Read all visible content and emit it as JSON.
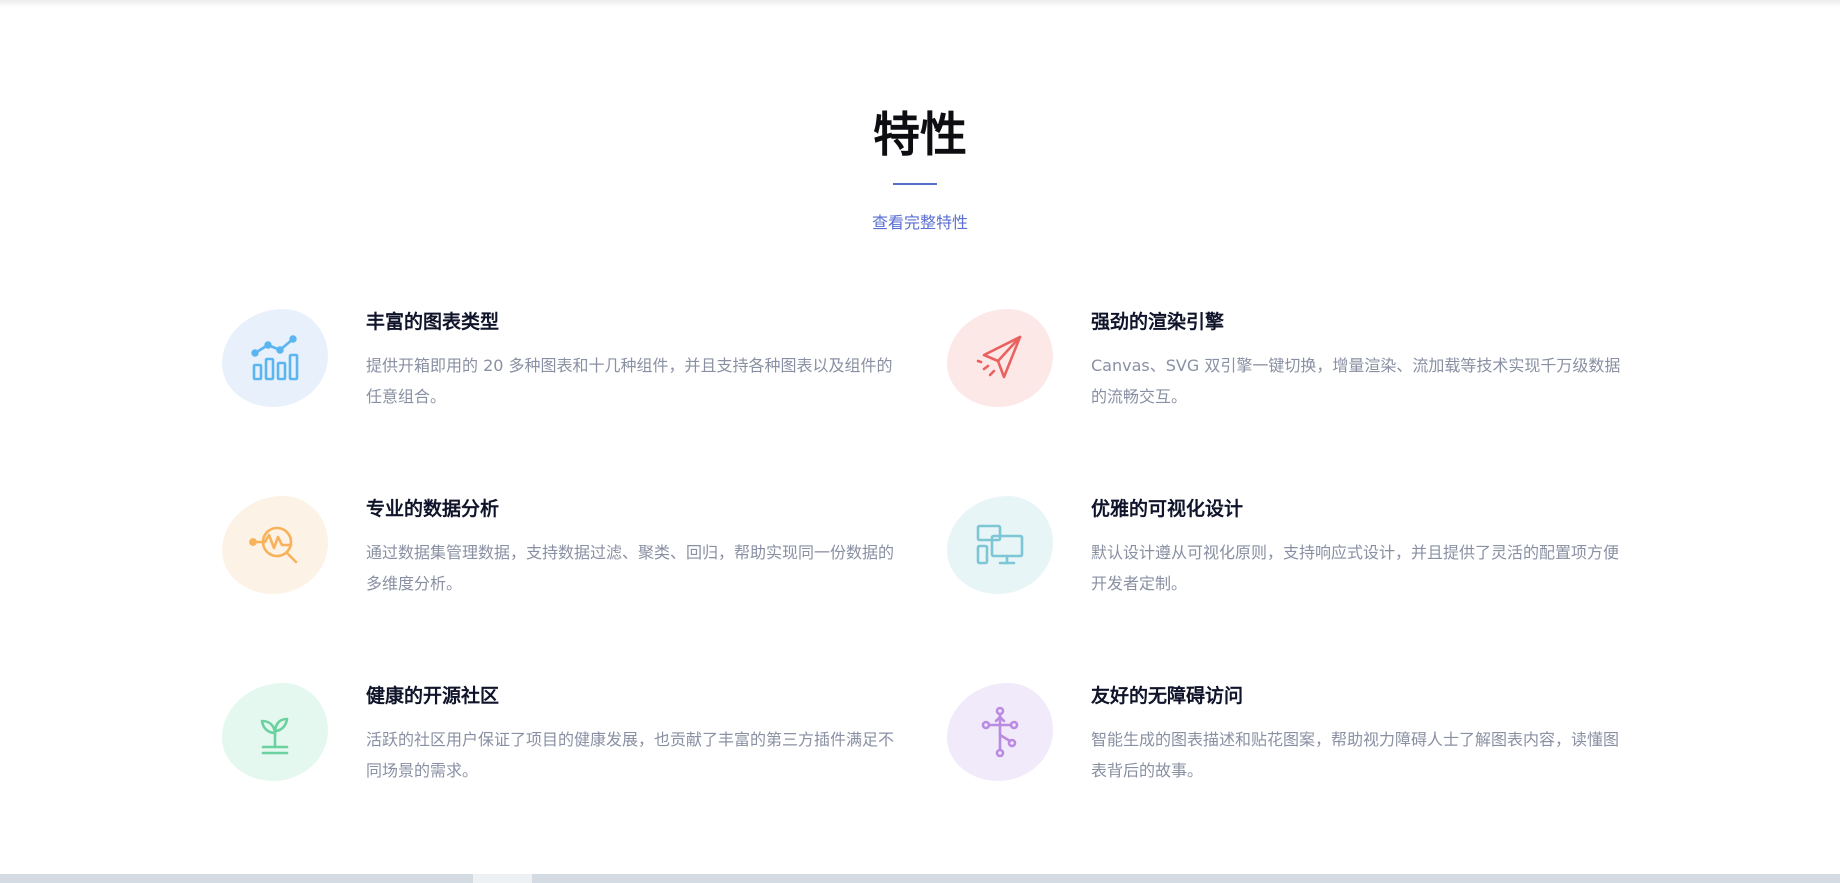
{
  "section": {
    "title": "特性",
    "more_link": "查看完整特性"
  },
  "features": [
    {
      "title": "丰富的图表类型",
      "desc": "提供开箱即用的 20 多种图表和十几种组件，并且支持各种图表以及组件的任意组合。",
      "icon": "bar-chart-icon",
      "blob_color": "#e8f1fb",
      "icon_color": "#5ab5f1"
    },
    {
      "title": "强劲的渲染引擎",
      "desc": "Canvas、SVG 双引擎一键切换，增量渲染、流加载等技术实现千万级数据的流畅交互。",
      "icon": "paper-plane-icon",
      "blob_color": "#fde8e8",
      "icon_color": "#e9625f"
    },
    {
      "title": "专业的数据分析",
      "desc": "通过数据集管理数据，支持数据过滤、聚类、回归，帮助实现同一份数据的多维度分析。",
      "icon": "data-analysis-icon",
      "blob_color": "#fdf2e6",
      "icon_color": "#f7b25b"
    },
    {
      "title": "优雅的可视化设计",
      "desc": "默认设计遵从可视化原则，支持响应式设计，并且提供了灵活的配置项方便开发者定制。",
      "icon": "responsive-devices-icon",
      "blob_color": "#e7f5f6",
      "icon_color": "#7cc6d6"
    },
    {
      "title": "健康的开源社区",
      "desc": "活跃的社区用户保证了项目的健康发展，也贡献了丰富的第三方插件满足不同场景的需求。",
      "icon": "sprout-icon",
      "blob_color": "#e4f8ef",
      "icon_color": "#6ad1a0"
    },
    {
      "title": "友好的无障碍访问",
      "desc": "智能生成的图表描述和贴花图案，帮助视力障碍人士了解图表内容，读懂图表背后的故事。",
      "icon": "accessibility-icon",
      "blob_color": "#f1eafa",
      "icon_color": "#bb8ae2"
    }
  ]
}
